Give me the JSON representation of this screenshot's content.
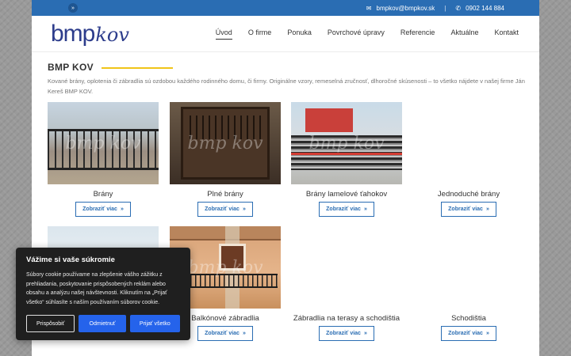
{
  "topbar": {
    "lang_icon": "double-chevron-icon",
    "email": "bmpkov@bmpkov.sk",
    "separator": "|",
    "phone": "0902 144 884"
  },
  "logo": {
    "part1": "bmp",
    "part2": "kov"
  },
  "nav": [
    {
      "label": "Úvod",
      "active": true
    },
    {
      "label": "O firme"
    },
    {
      "label": "Ponuka"
    },
    {
      "label": "Povrchové úpravy"
    },
    {
      "label": "Referencie"
    },
    {
      "label": "Aktuálne"
    },
    {
      "label": "Kontakt"
    }
  ],
  "main": {
    "title": "BMP KOV",
    "intro": "Kované brány, oplotenia či zábradlia sú ozdobou každého rodinného domu, či firmy. Originálne vzory, remeselná zručnosť, dlhoročné skúsenosti – to všetko nájdete v našej firme Ján Kereš BMP KOV.",
    "watermark": "bmp kov",
    "more_label": "Zobraziť viac",
    "products": [
      {
        "label": "Brány"
      },
      {
        "label": "Plné brány"
      },
      {
        "label": "Brány lamelové ťahokov"
      },
      {
        "label": "Jednoduché brány"
      },
      {
        "label": "Balkónové zábradlia"
      },
      {
        "label": "Zábradlia na terasy a schodištia"
      },
      {
        "label": "Schodištia"
      }
    ]
  },
  "cookie": {
    "title": "Vážime si vaše súkromie",
    "text": "Súbory cookie používame na zlepšenie vášho zážitku z prehliadania, poskytovanie prispôsobených reklám alebo obsahu a analýzu našej návštevnosti. Kliknutím na „Prijať všetko“ súhlasíte s naším používaním súborov cookie.",
    "customize": "Prispôsobiť",
    "reject": "Odmietnuť",
    "accept": "Prijať všetko"
  },
  "colors": {
    "accent": "#2a6db3",
    "title_underline": "#f0c419",
    "cookie_bg": "#1f1f1f",
    "cookie_button": "#2563eb"
  }
}
